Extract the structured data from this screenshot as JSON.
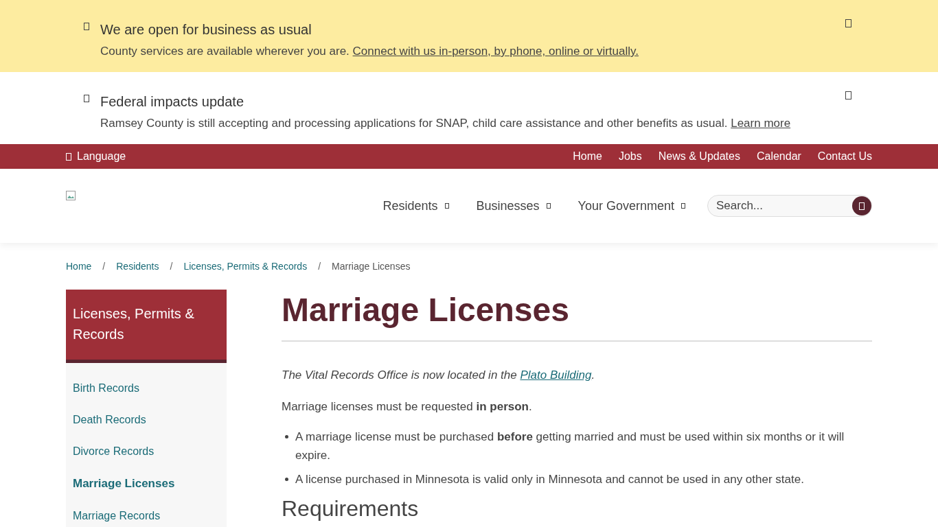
{
  "alerts": [
    {
      "title": "We are open for business as usual",
      "message": "County services are available wherever you are.",
      "link": "Connect with us in-person, by phone, online or virtually.",
      "kind": "highlight"
    },
    {
      "title": "Federal impacts update",
      "message": "Ramsey County is still accepting and processing applications for SNAP, child care assistance and other benefits as usual.",
      "link": "Learn more",
      "kind": "plain"
    }
  ],
  "utility_bar": {
    "language": "Language",
    "links": [
      "Home",
      "Jobs",
      "News & Updates",
      "Calendar",
      "Contact Us"
    ]
  },
  "main_nav": {
    "items": [
      "Residents",
      "Businesses",
      "Your Government"
    ],
    "search": {
      "placeholder": "Search..."
    }
  },
  "breadcrumb_separator": "/",
  "breadcrumb": [
    {
      "label": "Home",
      "current": false
    },
    {
      "label": "Residents",
      "current": false
    },
    {
      "label": "Licenses, Permits & Records",
      "current": false
    },
    {
      "label": "Marriage Licenses",
      "current": true
    }
  ],
  "sidebar": {
    "title": "Licenses, Permits & Records",
    "items": [
      {
        "label": "Birth Records",
        "selected": false
      },
      {
        "label": "Death Records",
        "selected": false
      },
      {
        "label": "Divorce Records",
        "selected": false
      },
      {
        "label": "Marriage Licenses",
        "selected": true
      },
      {
        "label": "Marriage Records",
        "selected": false
      }
    ]
  },
  "content": {
    "title": "Marriage Licenses",
    "notice": {
      "text": "The Vital Records Office is now located in the",
      "link": "Plato Building",
      "end": "."
    },
    "intro": "Marriage licenses must be requested **in person**.",
    "bullets": [
      "A marriage license must be purchased **before** getting married and must be used within six months or it will expire.",
      "A license purchased in Minnesota is valid only in Minnesota and cannot be used in any other state."
    ],
    "next_heading": "Requirements"
  }
}
